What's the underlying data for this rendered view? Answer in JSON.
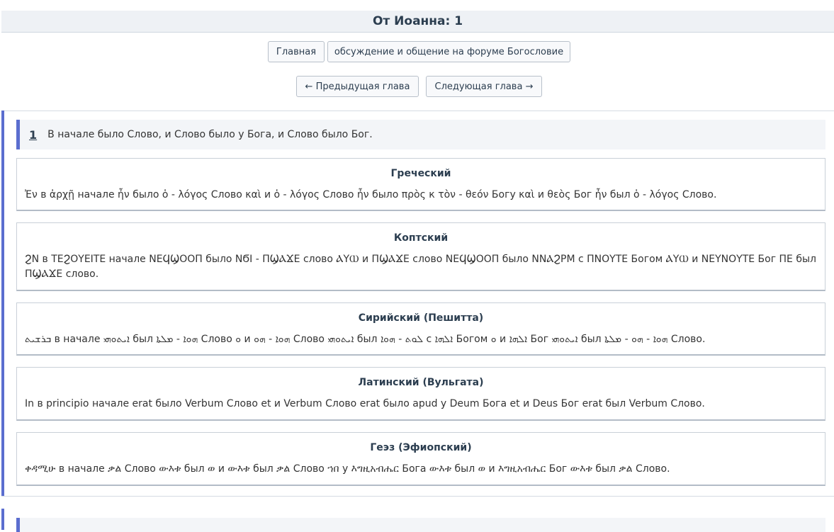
{
  "page": {
    "title": "От Иоанна: 1"
  },
  "nav": {
    "home_label": "Главная",
    "forum_label": "обсуждение и общение на форуме Богословие",
    "prev_label": "← Предыдущая глава",
    "next_label": "Следующая глава →"
  },
  "verse": {
    "number": "1",
    "text": "В начале было Слово, и Слово было у Бога, и Слово было Бог."
  },
  "translations": [
    {
      "title": "Греческий",
      "text": "Ἐν в ἀρχῇ начале ἦν было ὁ - λόγος Слово καὶ и ὁ - λόγος Слово ἦν было πρὸς к τὸν - θεόν Богу καὶ и θεὸς Бог ἦν был ὁ - λόγος Слово."
    },
    {
      "title": "Коптский",
      "text": "ϨΝ в ΤΕϨΟΥΕΙΤΕ начале ΝΕϤϢΟΟΠ было ΝϬΙ - ΠϢⲀϪΕ слово ⲀΥⲰ и ΠϢⲀϪΕ слово ΝΕϤϢΟΟΠ было ΝΝⲀϨΡΜ с ΠΝΟΥΤΕ Богом ⲀΥⲰ и ΝΕΥΝΟΥΤΕ Бог ΠΕ был ΠϢⲀϪΕ слово."
    },
    {
      "title": "Сирийский (Пешитта)",
      "text": "ܒܪܫܝܬ в начале ܐܝܬܘܗܝ был ܗܘܐ - ܡܠܬܐ Слово ܘ и ܗܘܐ - ܗܘ Слово ܐܝܬܘܗܝ был ܠܘܬ - ܗܘܐ с ܐܠܗܐ Богом ܘ и ܐܠܗܐ Бог ܐܝܬܘܗܝ был ܗܘܐ - ܗܘ - ܡܠܬܐ Слово."
    },
    {
      "title": "Латинский (Вульгата)",
      "text": "In в principio начале erat было Verbum Слово et и Verbum Слово erat было apud у Deum Бога et и Deus Бог erat был Verbum Слово."
    },
    {
      "title": "Геэз (Эфиопский)",
      "text": "ቀዳሚሁ в начале ቃል Слово ውእቱ был ወ и ውእቱ был ቃል Слово ኀበ у እግዚአብሔር Бога ውእቱ был ወ и እግዚአብሔር Бог ውእቱ был ቃል Слово."
    }
  ]
}
